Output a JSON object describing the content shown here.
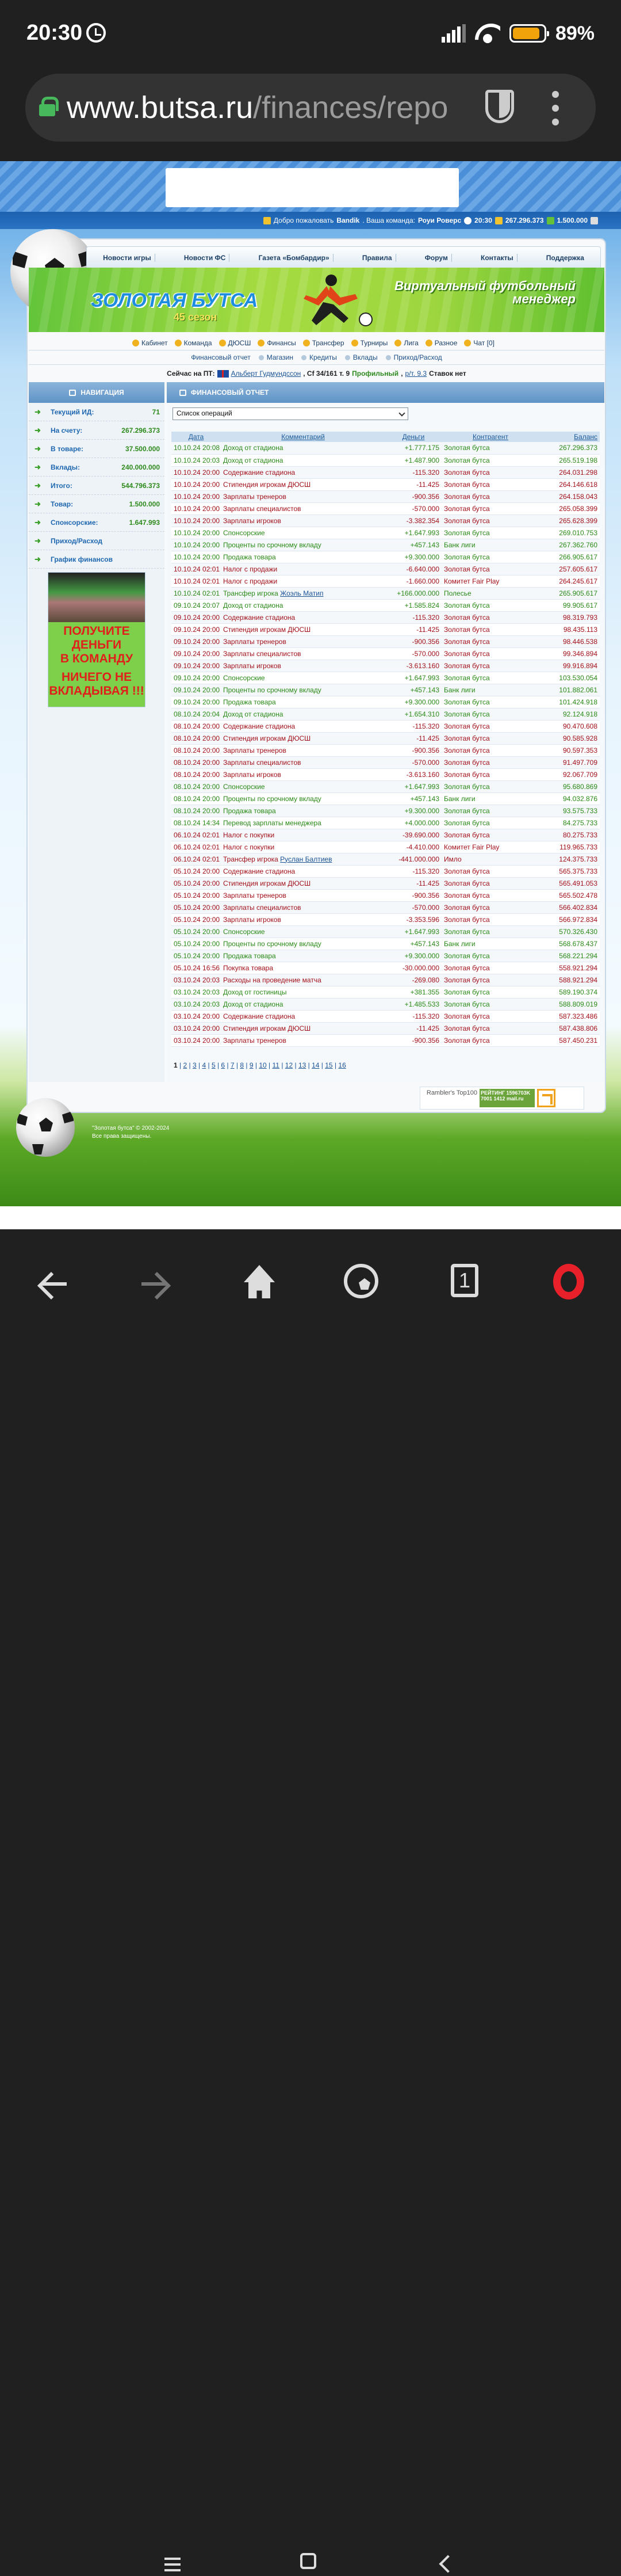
{
  "statusbar": {
    "time": "20:30",
    "battery": "89%",
    "battery_level": 0.89,
    "icons": [
      "alarm-icon",
      "signal-icon",
      "wifi-icon",
      "battery-icon"
    ]
  },
  "browser": {
    "url_host": "www.butsa.ru",
    "url_path": "/finances/repo",
    "icons": [
      "lock-icon",
      "shield-icon",
      "more-vert-icon"
    ]
  },
  "welcome": {
    "text": "Добро пожаловать",
    "user": "Bandik",
    "team_label": ". Ваша команда:",
    "team": "Роуи Роверс",
    "time": "20:30",
    "money": "267.296.373",
    "goods": "1.500.000"
  },
  "topmenu": [
    "Новости игры",
    "Новости ФС",
    "Газета «Бомбардир»",
    "Правила",
    "Форум",
    "Контакты",
    "Поддержка"
  ],
  "banner": {
    "title": "ЗОЛОТАЯ БУТСА",
    "season": "45 сезон",
    "slogan": "Виртуальный футбольный менеджер"
  },
  "gamenav": [
    "Кабинет",
    "Команда",
    "ДЮСШ",
    "Финансы",
    "Трансфер",
    "Турниры",
    "Лига",
    "Разное",
    "Чат [0]"
  ],
  "subnav": [
    "Финансовый отчет",
    "Магазин",
    "Кредиты",
    "Вклады",
    "Приход/Расход"
  ],
  "pt": {
    "prefix": "Сейчас на ПТ:",
    "player": "Альберт Гудмундссон",
    "mid": ", Cf 34/161 т. 9",
    "prof": "Профильный",
    "sep": ",",
    "rt": "р/т. 9.3",
    "bets": "Ставок нет"
  },
  "sidebar": {
    "heading": "НАВИГАЦИЯ",
    "items": [
      {
        "label": "Текущий ИД:",
        "value": "71"
      },
      {
        "label": "На счету:",
        "value": "267.296.373"
      },
      {
        "label": "В товаре:",
        "value": "37.500.000"
      },
      {
        "label": "Вклады:",
        "value": "240.000.000"
      },
      {
        "label": "Итого:",
        "value": "544.796.373"
      },
      {
        "label": "Товар:",
        "value": "1.500.000"
      },
      {
        "label": "Спонсорские:",
        "value": "1.647.993"
      },
      {
        "label": "Приход/Расход",
        "value": ""
      },
      {
        "label": "График финансов",
        "value": ""
      }
    ],
    "ad_lines": [
      "ПОЛУЧИТЕ",
      "ДЕНЬГИ",
      "В КОМАНДУ",
      "НИЧЕГО НЕ",
      "ВКЛАДЫВАЯ !!!"
    ]
  },
  "main": {
    "heading": "ФИНАНСОВЫЙ ОТЧЕТ",
    "select_value": "Список операций",
    "columns": [
      "Дата",
      "Комментарий",
      "Деньги",
      "Контрагент",
      "Баланс"
    ],
    "income_color": "#2a8a17",
    "expense_color": "#a3101a",
    "rows": [
      [
        "10.10.24 20:08",
        "Доход от стадиона",
        "+1.777.175",
        "Золотая бутса",
        "267.296.373"
      ],
      [
        "10.10.24 20:03",
        "Доход от стадиона",
        "+1.487.900",
        "Золотая бутса",
        "265.519.198"
      ],
      [
        "10.10.24 20:00",
        "Содержание стадиона",
        "-115.320",
        "Золотая бутса",
        "264.031.298"
      ],
      [
        "10.10.24 20:00",
        "Стипендия игрокам ДЮСШ",
        "-11.425",
        "Золотая бутса",
        "264.146.618"
      ],
      [
        "10.10.24 20:00",
        "Зарплаты тренеров",
        "-900.356",
        "Золотая бутса",
        "264.158.043"
      ],
      [
        "10.10.24 20:00",
        "Зарплаты специалистов",
        "-570.000",
        "Золотая бутса",
        "265.058.399"
      ],
      [
        "10.10.24 20:00",
        "Зарплаты игроков",
        "-3.382.354",
        "Золотая бутса",
        "265.628.399"
      ],
      [
        "10.10.24 20:00",
        "Спонсорские",
        "+1.647.993",
        "Золотая бутса",
        "269.010.753"
      ],
      [
        "10.10.24 20:00",
        "Проценты по срочному вкладу",
        "+457.143",
        "Банк лиги",
        "267.362.760"
      ],
      [
        "10.10.24 20:00",
        "Продажа товара",
        "+9.300.000",
        "Золотая бутса",
        "266.905.617"
      ],
      [
        "10.10.24 02:01",
        "Налог с продажи",
        "-6.640.000",
        "Золотая бутса",
        "257.605.617"
      ],
      [
        "10.10.24 02:01",
        "Налог с продажи",
        "-1.660.000",
        "Комитет Fair Play",
        "264.245.617"
      ],
      [
        "10.10.24 02:01",
        "Трансфер игрока |Жоэль Матип",
        "+166.000.000",
        "Полесье",
        "265.905.617"
      ],
      [
        "09.10.24 20:07",
        "Доход от стадиона",
        "+1.585.824",
        "Золотая бутса",
        "99.905.617"
      ],
      [
        "09.10.24 20:00",
        "Содержание стадиона",
        "-115.320",
        "Золотая бутса",
        "98.319.793"
      ],
      [
        "09.10.24 20:00",
        "Стипендия игрокам ДЮСШ",
        "-11.425",
        "Золотая бутса",
        "98.435.113"
      ],
      [
        "09.10.24 20:00",
        "Зарплаты тренеров",
        "-900.356",
        "Золотая бутса",
        "98.446.538"
      ],
      [
        "09.10.24 20:00",
        "Зарплаты специалистов",
        "-570.000",
        "Золотая бутса",
        "99.346.894"
      ],
      [
        "09.10.24 20:00",
        "Зарплаты игроков",
        "-3.613.160",
        "Золотая бутса",
        "99.916.894"
      ],
      [
        "09.10.24 20:00",
        "Спонсорские",
        "+1.647.993",
        "Золотая бутса",
        "103.530.054"
      ],
      [
        "09.10.24 20:00",
        "Проценты по срочному вкладу",
        "+457.143",
        "Банк лиги",
        "101.882.061"
      ],
      [
        "09.10.24 20:00",
        "Продажа товара",
        "+9.300.000",
        "Золотая бутса",
        "101.424.918"
      ],
      [
        "08.10.24 20:04",
        "Доход от стадиона",
        "+1.654.310",
        "Золотая бутса",
        "92.124.918"
      ],
      [
        "08.10.24 20:00",
        "Содержание стадиона",
        "-115.320",
        "Золотая бутса",
        "90.470.608"
      ],
      [
        "08.10.24 20:00",
        "Стипендия игрокам ДЮСШ",
        "-11.425",
        "Золотая бутса",
        "90.585.928"
      ],
      [
        "08.10.24 20:00",
        "Зарплаты тренеров",
        "-900.356",
        "Золотая бутса",
        "90.597.353"
      ],
      [
        "08.10.24 20:00",
        "Зарплаты специалистов",
        "-570.000",
        "Золотая бутса",
        "91.497.709"
      ],
      [
        "08.10.24 20:00",
        "Зарплаты игроков",
        "-3.613.160",
        "Золотая бутса",
        "92.067.709"
      ],
      [
        "08.10.24 20:00",
        "Спонсорские",
        "+1.647.993",
        "Золотая бутса",
        "95.680.869"
      ],
      [
        "08.10.24 20:00",
        "Проценты по срочному вкладу",
        "+457.143",
        "Банк лиги",
        "94.032.876"
      ],
      [
        "08.10.24 20:00",
        "Продажа товара",
        "+9.300.000",
        "Золотая бутса",
        "93.575.733"
      ],
      [
        "08.10.24 14:34",
        "Перевод зарплаты менеджера",
        "+4.000.000",
        "Золотая бутса",
        "84.275.733"
      ],
      [
        "06.10.24 02:01",
        "Налог с покупки",
        "-39.690.000",
        "Золотая бутса",
        "80.275.733"
      ],
      [
        "06.10.24 02:01",
        "Налог с покупки",
        "-4.410.000",
        "Комитет Fair Play",
        "119.965.733"
      ],
      [
        "06.10.24 02:01",
        "Трансфер игрока |Руслан Балтиев",
        "-441.000.000",
        "Имло",
        "124.375.733"
      ],
      [
        "05.10.24 20:00",
        "Содержание стадиона",
        "-115.320",
        "Золотая бутса",
        "565.375.733"
      ],
      [
        "05.10.24 20:00",
        "Стипендия игрокам ДЮСШ",
        "-11.425",
        "Золотая бутса",
        "565.491.053"
      ],
      [
        "05.10.24 20:00",
        "Зарплаты тренеров",
        "-900.356",
        "Золотая бутса",
        "565.502.478"
      ],
      [
        "05.10.24 20:00",
        "Зарплаты специалистов",
        "-570.000",
        "Золотая бутса",
        "566.402.834"
      ],
      [
        "05.10.24 20:00",
        "Зарплаты игроков",
        "-3.353.596",
        "Золотая бутса",
        "566.972.834"
      ],
      [
        "05.10.24 20:00",
        "Спонсорские",
        "+1.647.993",
        "Золотая бутса",
        "570.326.430"
      ],
      [
        "05.10.24 20:00",
        "Проценты по срочному вкладу",
        "+457.143",
        "Банк лиги",
        "568.678.437"
      ],
      [
        "05.10.24 20:00",
        "Продажа товара",
        "+9.300.000",
        "Золотая бутса",
        "568.221.294"
      ],
      [
        "05.10.24 16:56",
        "Покупка товара",
        "-30.000.000",
        "Золотая бутса",
        "558.921.294"
      ],
      [
        "03.10.24 20:03",
        "Расходы на проведение матча",
        "-269.080",
        "Золотая бутса",
        "588.921.294"
      ],
      [
        "03.10.24 20:03",
        "Доход от гостиницы",
        "+381.355",
        "Золотая бутса",
        "589.190.374"
      ],
      [
        "03.10.24 20:03",
        "Доход от стадиона",
        "+1.485.533",
        "Золотая бутса",
        "588.809.019"
      ],
      [
        "03.10.24 20:00",
        "Содержание стадиона",
        "-115.320",
        "Золотая бутса",
        "587.323.486"
      ],
      [
        "03.10.24 20:00",
        "Стипендия игрокам ДЮСШ",
        "-11.425",
        "Золотая бутса",
        "587.438.806"
      ],
      [
        "03.10.24 20:00",
        "Зарплаты тренеров",
        "-900.356",
        "Золотая бутса",
        "587.450.231"
      ]
    ],
    "pager_current": "1",
    "pager_pages": [
      "2",
      "3",
      "4",
      "5",
      "6",
      "7",
      "8",
      "9",
      "10",
      "11",
      "12",
      "13",
      "14",
      "15",
      "16"
    ]
  },
  "counters": {
    "rambler": "Rambler's Top100",
    "mailru": "РЕЙТИНГ 1596703K 7001 1412 mail.ru"
  },
  "footer": {
    "line1": "\"Золотая бутса\" © 2002-2024",
    "line2": "Все права защищены."
  },
  "navbar": {
    "tab_count": "1",
    "icons": [
      "back-icon",
      "forward-icon",
      "home-icon",
      "soccer-ball-icon",
      "tabs-icon",
      "opera-icon"
    ]
  }
}
